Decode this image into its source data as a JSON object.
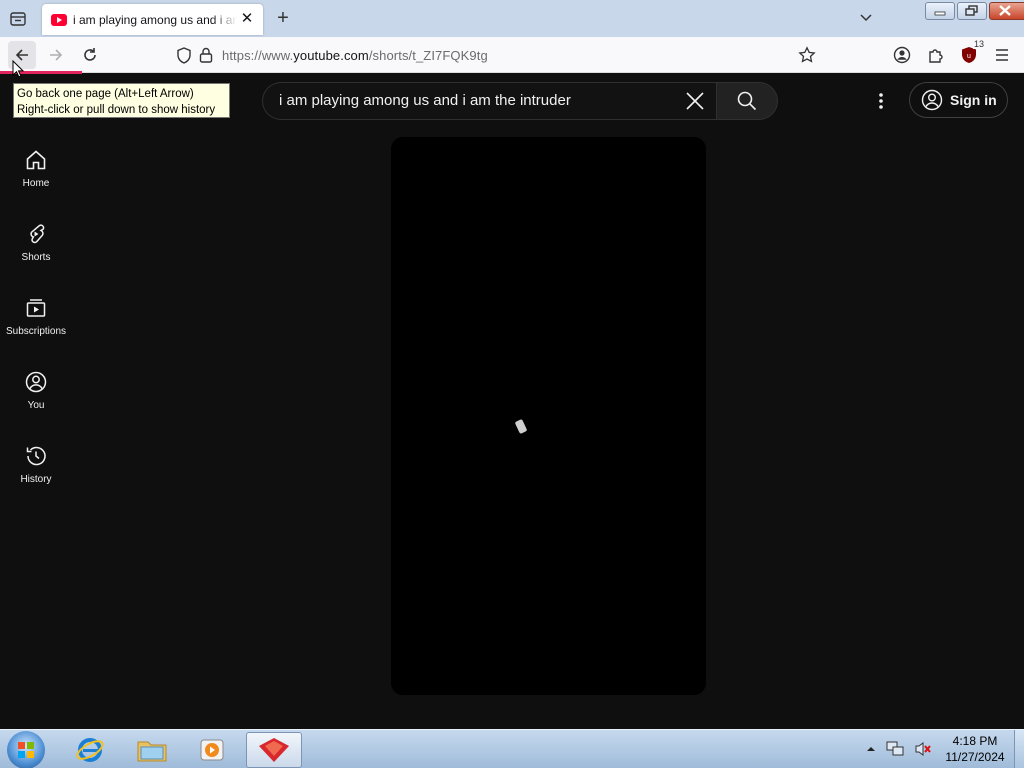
{
  "browser": {
    "tab": {
      "title": "i am playing among us and i am the intruder - YouTube"
    },
    "url": {
      "prefix": "https://www.",
      "host": "youtube.com",
      "path": "/shorts/t_ZI7FQK9tg"
    },
    "extension_badge": "13",
    "tooltip": {
      "line1": "Go back one page (Alt+Left Arrow)",
      "line2": "Right-click or pull down to show history"
    }
  },
  "youtube": {
    "search": {
      "query": "i am playing among us and i am the intruder"
    },
    "signin_label": "Sign in",
    "sidebar": [
      {
        "label": "Home",
        "icon": "home-icon"
      },
      {
        "label": "Shorts",
        "icon": "shorts-icon"
      },
      {
        "label": "Subscriptions",
        "icon": "subscriptions-icon"
      },
      {
        "label": "You",
        "icon": "you-icon"
      },
      {
        "label": "History",
        "icon": "history-icon"
      }
    ]
  },
  "taskbar": {
    "time": "4:18 PM",
    "date": "11/27/2024"
  },
  "colors": {
    "yt_bg": "#0f0f0f",
    "loading_bar": "#e0245e",
    "yt_red": "#ff0033"
  }
}
